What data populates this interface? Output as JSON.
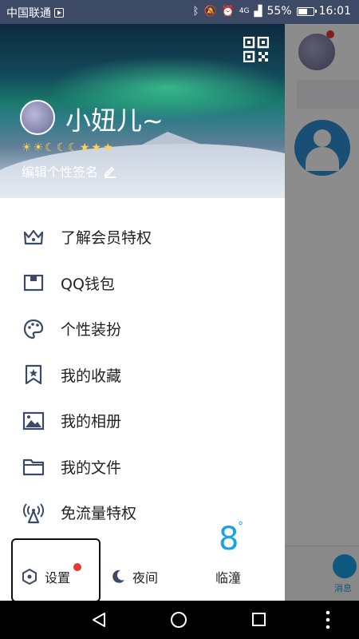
{
  "status_bar": {
    "carrier": "中国联通",
    "network": "4G",
    "battery": "55%",
    "time": "16:01"
  },
  "profile": {
    "nickname": "小妞儿~",
    "level_icons": [
      "sun",
      "sun",
      "moon",
      "moon",
      "moon",
      "star",
      "star",
      "star"
    ],
    "edit_signature": "编辑个性签名"
  },
  "menu": {
    "items": [
      {
        "label": "了解会员特权",
        "icon": "crown-icon"
      },
      {
        "label": "QQ钱包",
        "icon": "wallet-icon"
      },
      {
        "label": "个性装扮",
        "icon": "palette-icon"
      },
      {
        "label": "我的收藏",
        "icon": "bookmark-star-icon"
      },
      {
        "label": "我的相册",
        "icon": "image-icon"
      },
      {
        "label": "我的文件",
        "icon": "folder-icon"
      },
      {
        "label": "免流量特权",
        "icon": "antenna-icon"
      }
    ]
  },
  "bottom": {
    "settings_label": "设置",
    "night_label": "夜间",
    "weather": {
      "temp": "8",
      "unit": "°",
      "city": "临潼"
    }
  },
  "background": {
    "tab_label": "消息"
  },
  "colors": {
    "accent": "#1ba1e8",
    "badge": "#e53935",
    "status_bar": "#3d4a66"
  }
}
